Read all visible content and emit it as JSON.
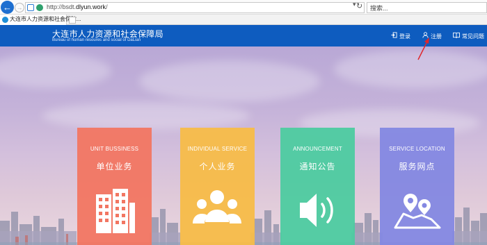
{
  "browser": {
    "url_prefix": "http://bsdt.",
    "url_domain": "dlyun.work",
    "url_suffix": "/",
    "url_tools": "▾",
    "search_placeholder": "搜索...",
    "tab_title": "大连市人力资源和社会保障...",
    "tab_close": "×"
  },
  "header": {
    "title": "大连市人力资源和社会保障局",
    "subtitle": "Bureau of human resoures and social of DaLian",
    "nav": {
      "login": "登录",
      "register": "注册",
      "faq": "常见问题"
    }
  },
  "cards": {
    "unit": {
      "en": "UNIT BUSSINESS",
      "cn": "单位业务",
      "color": "#f27662",
      "icon": "building-icon"
    },
    "individual": {
      "en": "INDIVIDUAL SERVICE",
      "cn": "个人业务",
      "color": "#f7bc48",
      "icon": "people-icon"
    },
    "announce": {
      "en": "ANNOUNCEMENT",
      "cn": "通知公告",
      "color": "#4dcba0",
      "icon": "speaker-icon"
    },
    "location": {
      "en": "SERVICE LOCATION",
      "cn": "服务网点",
      "color": "#8488e2",
      "icon": "map-pin-icon"
    }
  },
  "colors": {
    "header_bg": "#0e5cbf",
    "arrow": "#e0262b"
  }
}
